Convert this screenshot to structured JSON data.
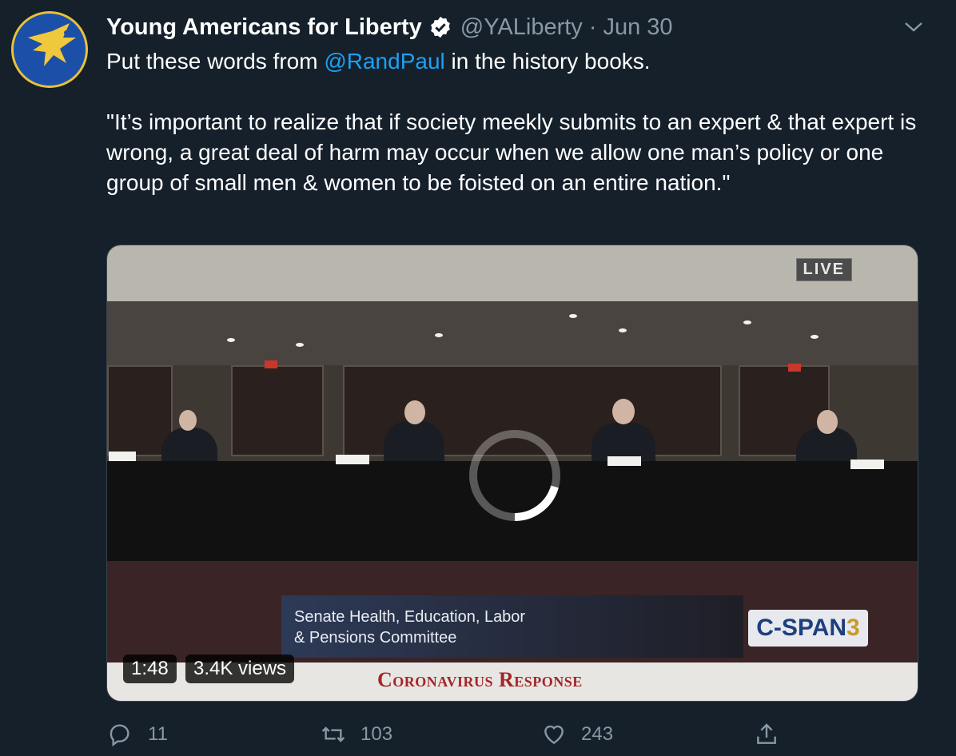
{
  "tweet": {
    "author_name": "Young Americans for Liberty",
    "handle": "@YALiberty",
    "separator": "·",
    "date": "Jun 30",
    "line1_prefix": "Put these words from ",
    "line1_mention": "@RandPaul",
    "line1_suffix": " in the history books.",
    "quote": "\"It’s important to realize that if society meekly submits to an expert & that expert is wrong, a great deal of harm may occur when we allow one man’s policy or one group of small men & women to be foisted on an entire nation.\""
  },
  "media": {
    "live_label": "LIVE",
    "lower_third_line1": "Senate Health, Education, Labor",
    "lower_third_line2": "& Pensions Committee",
    "cspan_main": "C-SPAN",
    "cspan_num": "3",
    "ribbon_text": "Coronavirus Response",
    "duration": "1:48",
    "views": "3.4K views"
  },
  "actions": {
    "reply_count": "11",
    "retweet_count": "103",
    "like_count": "243"
  },
  "colors": {
    "background": "#15202b",
    "accent": "#1da1f2",
    "muted": "#8899a6"
  },
  "icons": [
    "avatar-eagle",
    "verified-badge-icon",
    "chevron-down-icon",
    "spinner-icon",
    "reply-icon",
    "retweet-icon",
    "like-icon",
    "share-icon"
  ]
}
